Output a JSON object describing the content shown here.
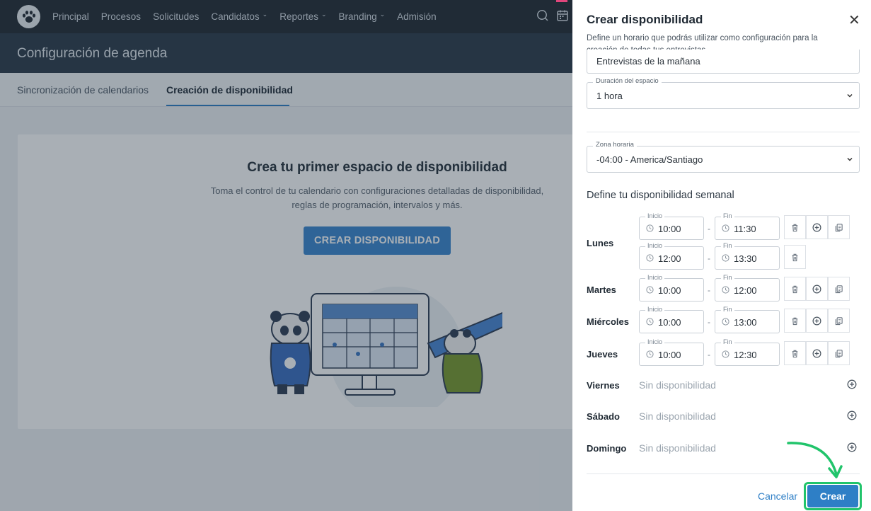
{
  "nav": {
    "items": [
      {
        "label": "Principal",
        "dropdown": false
      },
      {
        "label": "Procesos",
        "dropdown": false
      },
      {
        "label": "Solicitudes",
        "dropdown": false
      },
      {
        "label": "Candidatos",
        "dropdown": true
      },
      {
        "label": "Reportes",
        "dropdown": true
      },
      {
        "label": "Branding",
        "dropdown": true
      },
      {
        "label": "Admisión",
        "dropdown": false
      }
    ],
    "icons": [
      "chat-icon",
      "calendar-icon",
      "paw-logo-icon"
    ]
  },
  "page": {
    "title": "Configuración de agenda",
    "tabs": [
      "Sincronización de calendarios",
      "Creación de disponibilidad"
    ]
  },
  "empty_state": {
    "title": "Crea tu primer espacio de disponibilidad",
    "description": "Toma el control de tu calendario con configuraciones detalladas de disponibilidad, reglas de programación, intervalos y más.",
    "button": "CREAR DISPONIBILIDAD"
  },
  "drawer": {
    "title": "Crear disponibilidad",
    "close": "✕",
    "description": "Define un horario que podrás utilizar como configuración para la creación de todas tus entrevistas.",
    "name_value": "Entrevistas de la mañana",
    "duration": {
      "label": "Duración del espacio",
      "value": "1 hora"
    },
    "timezone": {
      "label": "Zona horaria",
      "value": "-04:00 - America/Santiago"
    },
    "weekly_title": "Define tu disponibilidad semanal",
    "start_label": "Inicio",
    "end_label": "Fin",
    "no_availability": "Sin disponibilidad",
    "days": [
      {
        "name": "Lunes",
        "slots": [
          {
            "start": "10:00",
            "end": "11:30"
          },
          {
            "start": "12:00",
            "end": "13:30"
          }
        ]
      },
      {
        "name": "Martes",
        "slots": [
          {
            "start": "10:00",
            "end": "12:00"
          }
        ]
      },
      {
        "name": "Miércoles",
        "slots": [
          {
            "start": "10:00",
            "end": "13:00"
          }
        ]
      },
      {
        "name": "Jueves",
        "slots": [
          {
            "start": "10:00",
            "end": "12:30"
          }
        ]
      },
      {
        "name": "Viernes",
        "slots": []
      },
      {
        "name": "Sábado",
        "slots": []
      },
      {
        "name": "Domingo",
        "slots": []
      }
    ],
    "cancel": "Cancelar",
    "submit": "Crear"
  },
  "colors": {
    "primary": "#2e7fc6",
    "highlight": "#21c46b",
    "nav_bg": "#222b33",
    "pagebar_bg": "#2c3b4a"
  }
}
